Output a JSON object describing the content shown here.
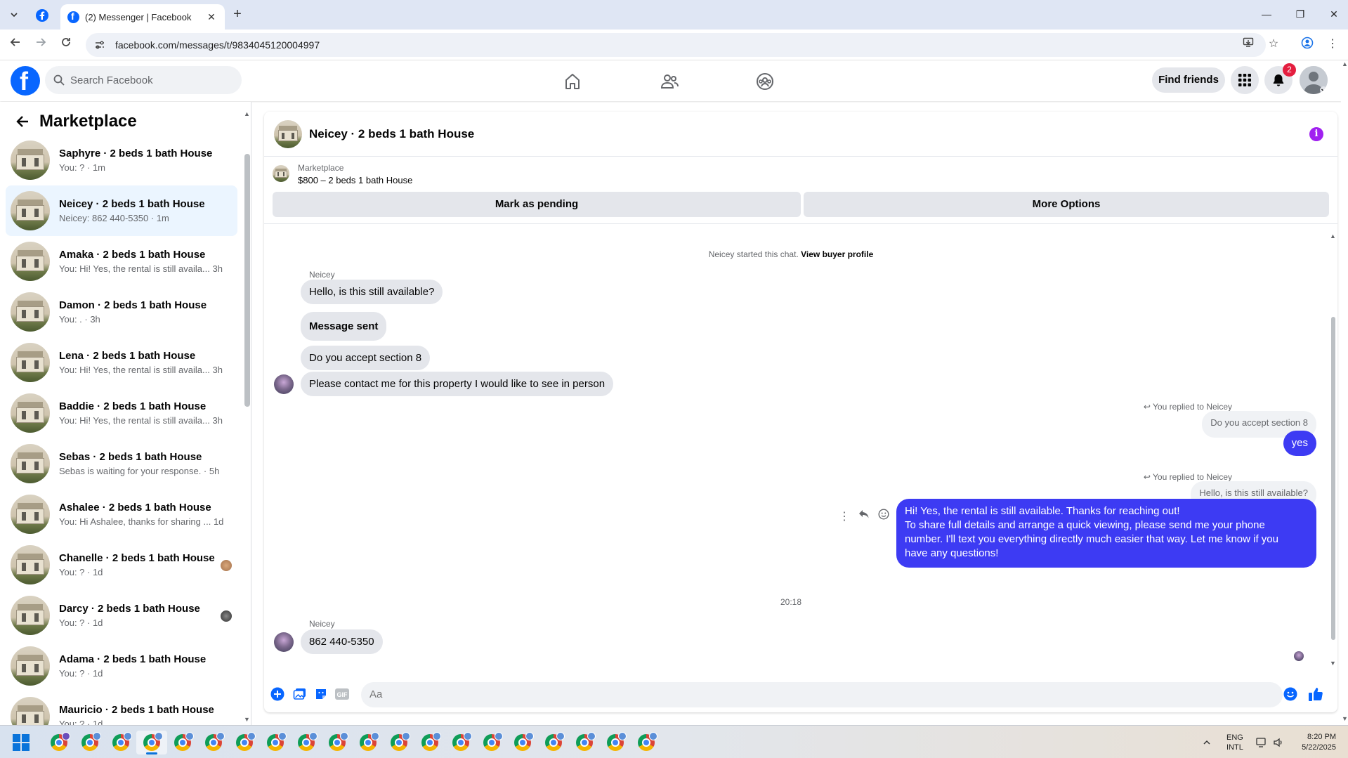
{
  "browser": {
    "tab_title": "(2) Messenger | Facebook",
    "url": "facebook.com/messages/t/9834045120004997"
  },
  "fb": {
    "search_placeholder": "Search Facebook",
    "find_friends": "Find friends",
    "notification_count": "2"
  },
  "sidebar": {
    "title": "Marketplace",
    "conversations": [
      {
        "name": "Saphyre · 2 beds 1 bath House",
        "preview": "You: ? · 1m",
        "active": false
      },
      {
        "name": "Neicey · 2 beds 1 bath House",
        "preview": "Neicey: 862 440-5350 · 1m",
        "active": true
      },
      {
        "name": "Amaka · 2 beds 1 bath House",
        "preview": "You: Hi! Yes, the rental is still availa...",
        "time": "3h"
      },
      {
        "name": "Damon · 2 beds 1 bath House",
        "preview": "You: . · 3h"
      },
      {
        "name": "Lena · 2 beds 1 bath House",
        "preview": "You: Hi! Yes, the rental is still availa...",
        "time": "3h"
      },
      {
        "name": "Baddie · 2 beds 1 bath House",
        "preview": "You: Hi! Yes, the rental is still availa...",
        "time": "3h"
      },
      {
        "name": "Sebas · 2 beds 1 bath House",
        "preview": "Sebas is waiting for your response. · 5h"
      },
      {
        "name": "Ashalee · 2 beds 1 bath House",
        "preview": "You: Hi Ashalee, thanks for sharing ...",
        "time": "1d"
      },
      {
        "name": "Chanelle · 2 beds 1 bath House",
        "preview": "You: ? · 1d"
      },
      {
        "name": "Darcy · 2 beds 1 bath House",
        "preview": "You: ? · 1d"
      },
      {
        "name": "Adama · 2 beds 1 bath House",
        "preview": "You: ? · 1d"
      },
      {
        "name": "Mauricio · 2 beds 1 bath House",
        "preview": "You: ? · 1d"
      }
    ]
  },
  "chat": {
    "title": "Neicey · 2 beds 1 bath House",
    "marketplace_label": "Marketplace",
    "listing": "$800 – 2 beds 1 bath House",
    "mark_pending": "Mark as pending",
    "more_options": "More Options",
    "started_text": "Neicey started this chat.",
    "view_profile": "View buyer profile",
    "sender_name": "Neicey",
    "incoming": [
      "Hello, is this still available?",
      "Message sent",
      "Do you accept section 8",
      "Please contact me for this property I would like to see in person"
    ],
    "reply1_label": "You replied to Neicey",
    "reply1_quote": "Do you accept section 8",
    "reply1_text": "yes",
    "reply2_label": "You replied to Neicey",
    "reply2_quote": "Hello, is this still available?",
    "reply2_lines": [
      "Hi! Yes, the rental is still available. Thanks for reaching out!",
      "To share full details and arrange a quick viewing, please send me your phone",
      "number. I'll text you everything directly much easier that way. Let me know if you",
      "have any questions!"
    ],
    "timestamp": "20:18",
    "last_sender": "Neicey",
    "last_message": "862 440-5350",
    "composer_placeholder": "Aa"
  },
  "taskbar": {
    "lang_line1": "ENG",
    "lang_line2": "INTL",
    "time": "8:20 PM",
    "date": "5/22/2025"
  },
  "colors": {
    "fb_blue": "#0866ff",
    "outgoing_bubble": "#3d3bf3",
    "incoming_bubble": "#e4e6eb",
    "active_conv": "#ebf5ff"
  }
}
